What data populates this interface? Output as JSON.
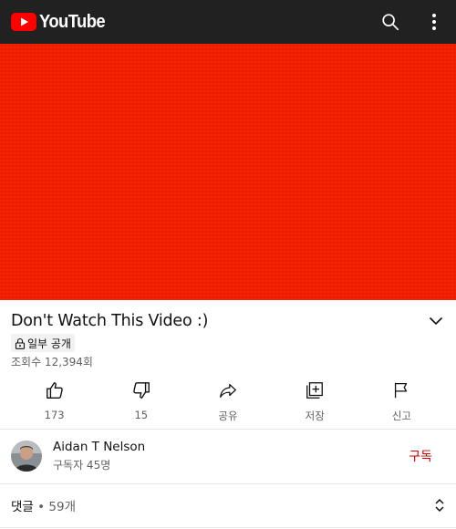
{
  "app": {
    "logo_text": "YouTube",
    "colors": {
      "brand": "#ff0000",
      "topbar": "#212121",
      "video": "#f32100",
      "subscribe": "#cc0000"
    }
  },
  "topbar": {
    "icons": [
      "search-icon",
      "more-vert-icon"
    ]
  },
  "video": {
    "title": "Don't Watch This Video :)",
    "privacy_badge": "일부 공개",
    "views": "조회수 12,394회"
  },
  "actions": [
    {
      "icon": "thumb-up-icon",
      "label": "173"
    },
    {
      "icon": "thumb-down-icon",
      "label": "15"
    },
    {
      "icon": "share-icon",
      "label": "공유"
    },
    {
      "icon": "save-playlist-icon",
      "label": "저장"
    },
    {
      "icon": "report-flag-icon",
      "label": "신고"
    }
  ],
  "channel": {
    "name": "Aidan T Nelson",
    "subscribers": "구독자 45명",
    "subscribe_label": "구독"
  },
  "comments": {
    "label": "댓글",
    "separator": "•",
    "count": "59개"
  }
}
